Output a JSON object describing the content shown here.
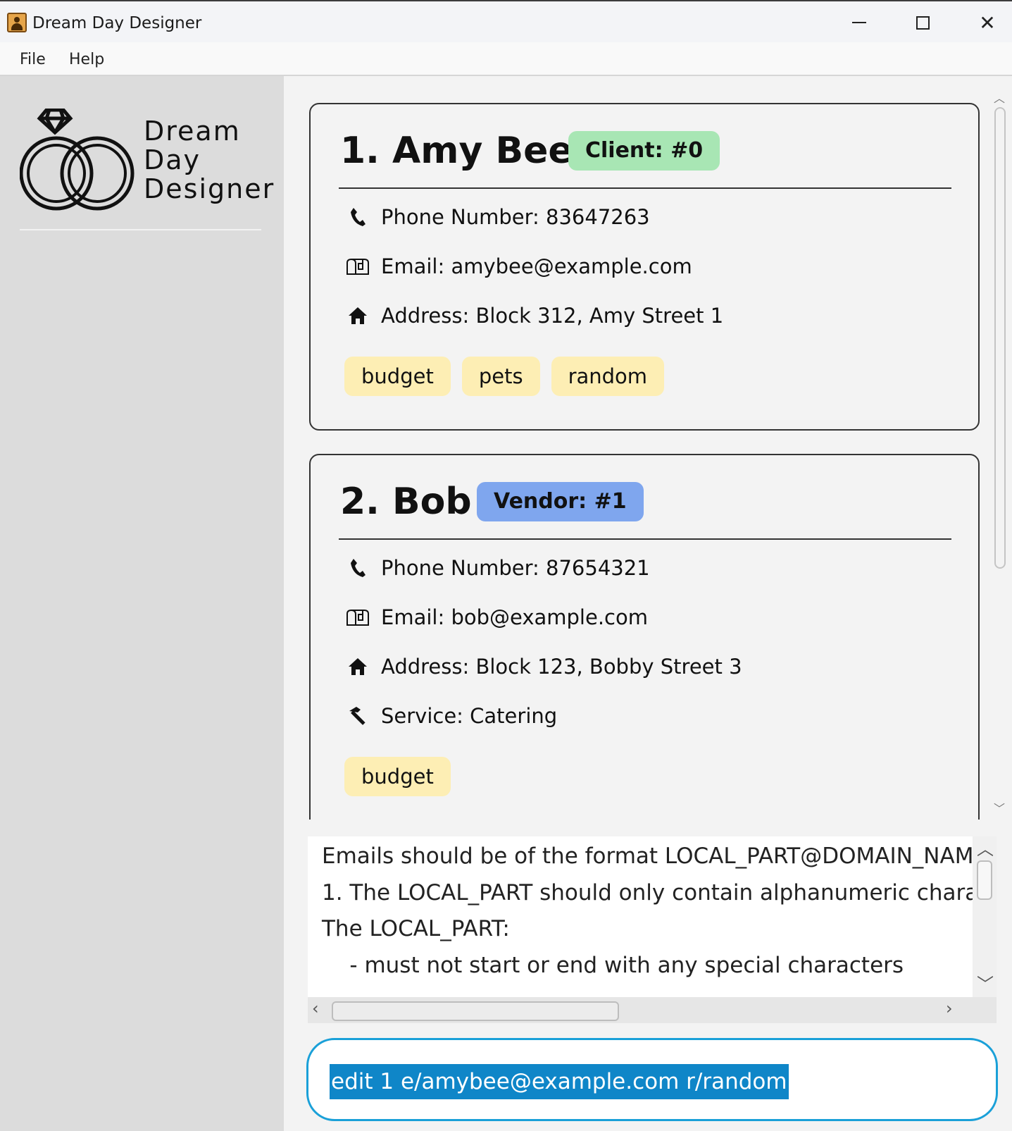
{
  "window": {
    "title": "Dream Day Designer",
    "close_glyph": "✕"
  },
  "menu": [
    {
      "label": "File"
    },
    {
      "label": "Help"
    }
  ],
  "sidebar": {
    "logo_text": [
      "Dream",
      "Day",
      "Designer"
    ]
  },
  "contacts": [
    {
      "name": "1. Amy Bee",
      "badge": "Client: #0",
      "badge_color": "#a8e6b4",
      "phone": "Phone Number: 83647263",
      "email": "Email: amybee@example.com",
      "address": "Address: Block 312, Amy Street 1",
      "tags": [
        "budget",
        "pets",
        "random"
      ]
    },
    {
      "name": "2. Bob",
      "badge": "Vendor: #1",
      "badge_color": "#7fa6ee",
      "phone": "Phone Number: 87654321",
      "email": "Email: bob@example.com",
      "address": "Address: Block 123, Bobby Street 3",
      "service": "Service: Catering",
      "tags": [
        "budget"
      ]
    }
  ],
  "result_display": {
    "lines": [
      "Emails should be of the format LOCAL_PART@DOMAIN_NAM",
      "1. The LOCAL_PART should only contain alphanumeric charac",
      "The LOCAL_PART:",
      "    - must not start or end with any special characters"
    ]
  },
  "command_box": {
    "value": "edit 1 e/amybee@example.com r/random"
  },
  "colors": {
    "accent": "#1aa0d8",
    "selection": "#0f86c8",
    "tag": "#fdeeb4"
  },
  "icons": [
    "phone-icon",
    "mailbox-icon",
    "home-icon",
    "hammer-icon",
    "rings-logo-icon"
  ]
}
